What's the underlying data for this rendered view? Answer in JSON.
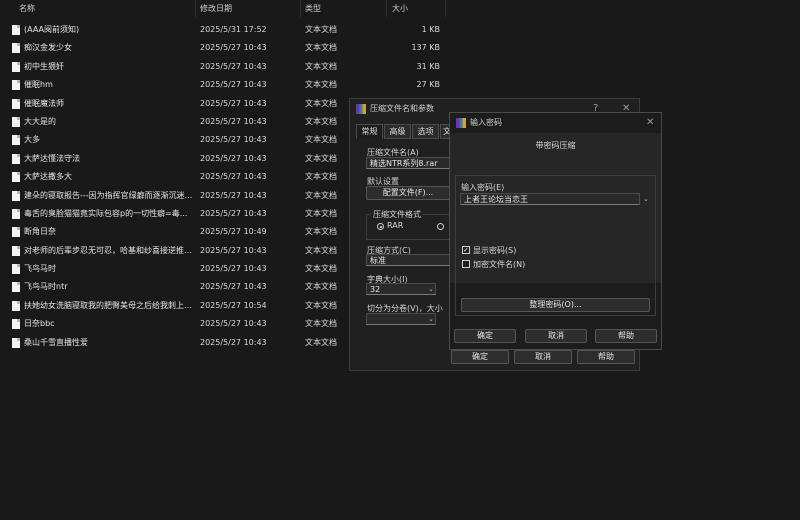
{
  "columns": {
    "name": "名称",
    "date": "修改日期",
    "type": "类型",
    "size": "大小"
  },
  "files": [
    {
      "name": "(AAA阅前须知)",
      "date": "2025/5/31 17:52",
      "type": "文本文档",
      "size": "1 KB"
    },
    {
      "name": "痴汉金发少女",
      "date": "2025/5/27 10:43",
      "type": "文本文档",
      "size": "137 KB"
    },
    {
      "name": "初中生猥奸",
      "date": "2025/5/27 10:43",
      "type": "文本文档",
      "size": "31 KB"
    },
    {
      "name": "催眠hm",
      "date": "2025/5/27 10:43",
      "type": "文本文档",
      "size": "27 KB"
    },
    {
      "name": "催眠魔法师",
      "date": "2025/5/27 10:43",
      "type": "文本文档",
      "size": ""
    },
    {
      "name": "大大是的",
      "date": "2025/5/27 10:43",
      "type": "文本文档",
      "size": ""
    },
    {
      "name": "大多",
      "date": "2025/5/27 10:43",
      "type": "文本文档",
      "size": ""
    },
    {
      "name": "大萨达懂法守法",
      "date": "2025/5/27 10:43",
      "type": "文本文档",
      "size": ""
    },
    {
      "name": "大萨达撒多大",
      "date": "2025/5/27 10:43",
      "type": "文本文档",
      "size": ""
    },
    {
      "name": "建朵的寝取报告---因为指挥官绿癖而逐渐沉迷...",
      "date": "2025/5/27 10:43",
      "type": "文本文档",
      "size": ""
    },
    {
      "name": "毒舌的臭脸猫猫竟实际包容p的一切性癖=毒...",
      "date": "2025/5/27 10:43",
      "type": "文本文档",
      "size": ""
    },
    {
      "name": "断角日奈",
      "date": "2025/5/27 10:49",
      "type": "文本文档",
      "size": ""
    },
    {
      "name": "对老师的后辈步忍无可忍，哈基和纱喜接逆推攫...",
      "date": "2025/5/27 10:43",
      "type": "文本文档",
      "size": ""
    },
    {
      "name": "飞鸟马时",
      "date": "2025/5/27 10:43",
      "type": "文本文档",
      "size": ""
    },
    {
      "name": "飞鸟马时ntr",
      "date": "2025/5/27 10:43",
      "type": "文本文档",
      "size": ""
    },
    {
      "name": "扶她幼女洗脑寝取我的肥臀美母之后给我刺上绝...",
      "date": "2025/5/27 10:54",
      "type": "文本文档",
      "size": ""
    },
    {
      "name": "日奈bbc",
      "date": "2025/5/27 10:43",
      "type": "文本文档",
      "size": ""
    },
    {
      "name": "桑山千雪直播性爱",
      "date": "2025/5/27 10:43",
      "type": "文本文档",
      "size": ""
    }
  ],
  "archive_dialog": {
    "title": "压缩文件名和参数",
    "help_glyph": "?",
    "close_glyph": "✕",
    "tabs": [
      "常规",
      "高级",
      "选项",
      "文"
    ],
    "archive_name_label": "压缩文件名(A)",
    "archive_name_value": "精选NTR系列8.rar",
    "default_settings_label": "默认设置",
    "profiles_button": "配置文件(F)...",
    "format_group_label": "压缩文件格式",
    "format_rar": "RAR",
    "method_label": "压缩方式(C)",
    "method_value": "标准",
    "dict_label": "字典大小(I)",
    "dict_value": "32",
    "split_label": "切分为分卷(V)，大小",
    "ok": "确定",
    "cancel": "取消",
    "help": "帮助"
  },
  "password_dialog": {
    "title": "输入密码",
    "close_glyph": "✕",
    "subtitle": "带密码压缩",
    "enter_label": "输入密码(E)",
    "password_value": "上者王论坛当恋王",
    "show_password": "显示密码(S)",
    "show_password_checked": true,
    "encrypt_names": "加密文件名(N)",
    "encrypt_names_checked": false,
    "organize_button": "整理密码(O)...",
    "ok": "确定",
    "cancel": "取消",
    "help": "帮助"
  }
}
